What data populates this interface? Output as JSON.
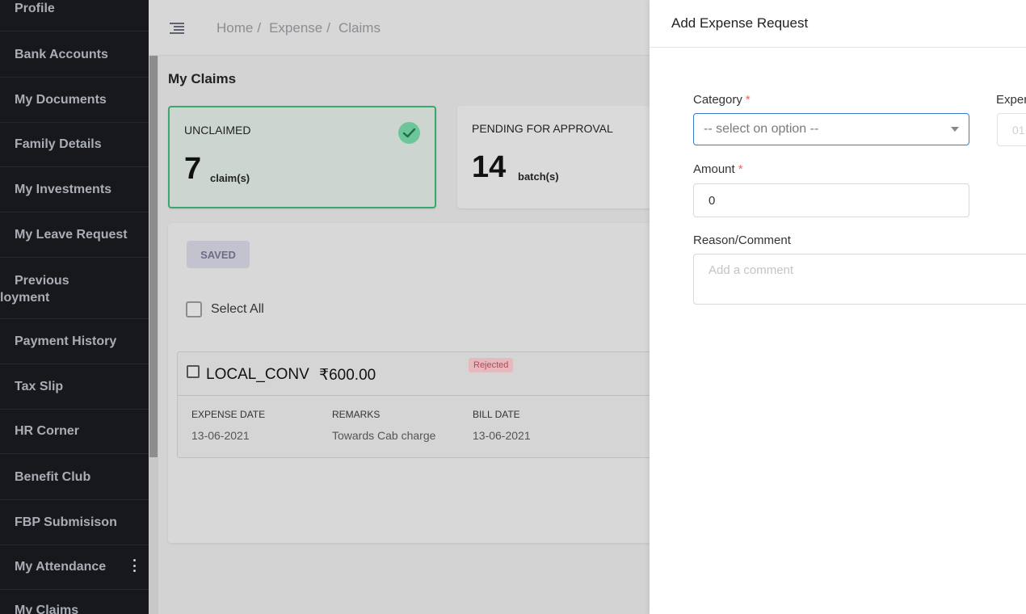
{
  "sidebar": {
    "items": [
      {
        "label": "Profile"
      },
      {
        "label": "Bank Accounts"
      },
      {
        "label": "My Documents"
      },
      {
        "label": "Family Details"
      },
      {
        "label": "My Investments"
      },
      {
        "label": "My Leave Request"
      },
      {
        "label_line1": "Previous",
        "label_line2": "loyment"
      },
      {
        "label": "Payment History"
      },
      {
        "label": "Tax Slip"
      },
      {
        "label": "HR Corner"
      },
      {
        "label": "Benefit Club"
      },
      {
        "label": "FBP Submisison"
      },
      {
        "label": "My Attendance"
      },
      {
        "label": "My Claims"
      }
    ]
  },
  "header": {
    "breadcrumb": [
      "Home",
      "Expense",
      "Claims"
    ],
    "separator": "/"
  },
  "page": {
    "title": "My Claims"
  },
  "stats": [
    {
      "label": "UNCLAIMED",
      "value": "7",
      "unit": "claim(s)"
    },
    {
      "label": "PENDING FOR APPROVAL",
      "value": "14",
      "unit": "batch(s)"
    }
  ],
  "claims_panel": {
    "tab_label": "SAVED",
    "select_all_label": "Select All",
    "claim": {
      "code": "LOCAL_CONV",
      "amount": "₹600.00",
      "status": "Rejected",
      "fields": [
        {
          "label": "EXPENSE DATE",
          "value": "13-06-2021"
        },
        {
          "label": "REMARKS",
          "value": "Towards Cab charge"
        },
        {
          "label": "BILL DATE",
          "value": "13-06-2021"
        }
      ]
    }
  },
  "drawer": {
    "title": "Add Expense Request",
    "category": {
      "label": "Category",
      "required": "*",
      "placeholder": "-- select on option --"
    },
    "expense_date": {
      "label": "Exper",
      "value": "01"
    },
    "amount": {
      "label": "Amount",
      "required": "*",
      "value": "0"
    },
    "reason": {
      "label": "Reason/Comment",
      "placeholder": "Add a comment"
    }
  },
  "colors": {
    "sidebar_bg": "#16181c",
    "accent_blue": "#3d7bd0",
    "success_green": "#3aa86e",
    "rejected_red": "#b34a57"
  }
}
